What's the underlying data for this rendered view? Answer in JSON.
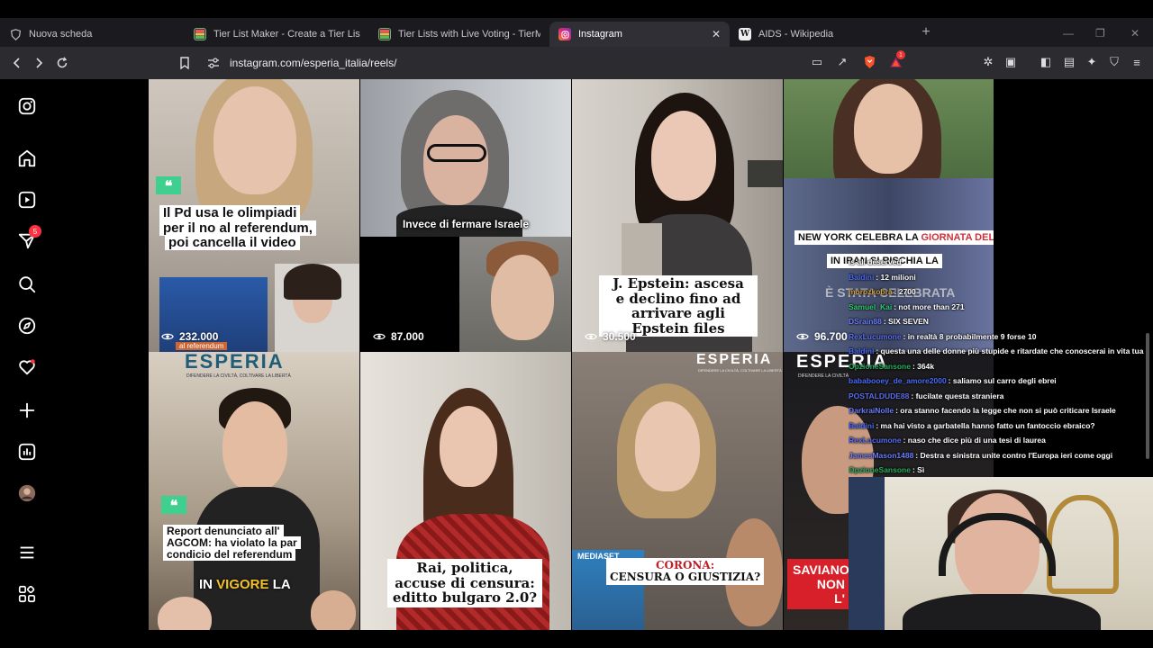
{
  "browser": {
    "tabs": [
      {
        "label": "Nuova scheda",
        "icon": "brave-shield-icon",
        "active": false
      },
      {
        "label": "Tier List Maker - Create a Tier List - T",
        "icon": "tiermaker-icon",
        "active": false
      },
      {
        "label": "Tier Lists with Live Voting - TierMaker",
        "icon": "tiermaker-icon",
        "active": false
      },
      {
        "label": "Instagram",
        "icon": "instagram-icon",
        "active": true
      },
      {
        "label": "AIDS - Wikipedia",
        "icon": "wikipedia-icon",
        "active": false
      }
    ],
    "new_tab": "+",
    "url": "instagram.com/esperia_italia/reels/",
    "rewards_badge": "1",
    "colors": {
      "tabbar": "#1b1b1f",
      "navbar": "#2b2b30",
      "active_tab": "#2f2f35",
      "brave_orange": "#fb542b"
    }
  },
  "sidebar": {
    "items": [
      {
        "name": "instagram-logo-icon"
      },
      {
        "name": "home-icon"
      },
      {
        "name": "reels-icon"
      },
      {
        "name": "messages-icon",
        "badge": "5"
      },
      {
        "name": "search-icon"
      },
      {
        "name": "explore-icon"
      },
      {
        "name": "notifications-icon"
      },
      {
        "name": "create-icon"
      },
      {
        "name": "dashboard-icon"
      },
      {
        "name": "profile-avatar"
      },
      {
        "name": "more-menu-icon"
      },
      {
        "name": "also-from-meta-icon"
      }
    ]
  },
  "reels": [
    {
      "caption": [
        "Il Pd usa le olimpiadi",
        "per il no al referendum,",
        "poi cancella il video"
      ],
      "views": "232.000",
      "sub_label": "al referendum"
    },
    {
      "caption": [
        "Invece di fermare Israele"
      ],
      "views": "87.000"
    },
    {
      "caption": [
        "J. Epstein: ascesa",
        "e declino fino ad",
        "arrivare agli",
        "Epstein files"
      ],
      "views": "30.500"
    },
    {
      "caption": [
        "NEW YORK CELEBRA LA GIORNATA DELL'HIJAB",
        "IN IRAN SI RISCHIA LA",
        "È STATA CELEBRATA"
      ],
      "highlight": "GIORNATA DELL'HIJAB",
      "views": "96.700"
    },
    {
      "brand": "ESPERIA",
      "brand_sub": "DIFENDERE LA CIVILTÀ, COLTIVARE LA LIBERTÀ",
      "caption": [
        "Report denunciato all'",
        "AGCOM: ha violato la par",
        "condicio del referendum"
      ],
      "banner": "IN VIGORE LA",
      "banner_highlight": "VIGORE"
    },
    {
      "caption": [
        "Rai, politica,",
        "accuse di censura:",
        "editto bulgaro 2.0?"
      ]
    },
    {
      "brand": "ESPERIA",
      "brand_sub": "DIFENDERE LA CIVILTÀ, COLTIVARE LA LIBERTÀ",
      "caption": [
        "CORONA:",
        "CENSURA O GIUSTIZIA?"
      ],
      "sub_label": "MEDIASET"
    },
    {
      "brand": "ESPERIA",
      "brand_sub": "DIFENDERE LA CIVILTÀ",
      "caption": [
        "SAVIANO",
        "NON",
        "L'"
      ]
    }
  ],
  "chat": [
    {
      "user": "",
      "text": "is all deserved",
      "color": "#ffffff"
    },
    {
      "user": "Baldini",
      "text": ": 12 milioni",
      "color": "#4a6cf7"
    },
    {
      "user": "morozkobra",
      "text": ": 2700",
      "color": "#d0a040"
    },
    {
      "user": "Samuel_Kai",
      "text": ": not more than 271",
      "color": "#2ecc71"
    },
    {
      "user": "DSrain88",
      "text": ": SIX SEVEN",
      "color": "#6a7cff"
    },
    {
      "user": "RexLucumone",
      "text": ": in realtà 8 probabilmente 9 forse 10",
      "color": "#5a6df0"
    },
    {
      "user": "Baldini",
      "text": ": questa una delle donne più stupide e ritardate che conoscerai in vita tua",
      "color": "#4a6cf7"
    },
    {
      "user": "OpzioneSansone",
      "text": ": 364k",
      "color": "#27ae60"
    },
    {
      "user": "bababooey_de_amore2000",
      "text": ": saliamo sul carro degli ebrei",
      "color": "#4a6cf7"
    },
    {
      "user": "POSTALDUDE88",
      "text": ": fucilate questa straniera",
      "color": "#5a6df0"
    },
    {
      "user": "DarkraiNolle",
      "text": ": ora stanno facendo la legge che non si può criticare Israele",
      "color": "#6a7cff"
    },
    {
      "user": "Baldini",
      "text": ": ma hai visto a garbatella hanno fatto un fantoccio ebraico?",
      "color": "#4a6cf7"
    },
    {
      "user": "RexLucumone",
      "text": ": naso che dice più di una tesi di laurea",
      "color": "#5a6df0"
    },
    {
      "user": "JamesMason1488",
      "text": ": Destra e sinistra unite contro l'Europa ieri come oggi",
      "color": "#6a7cff"
    },
    {
      "user": "OpzioneSansone",
      "text": ": Sì",
      "color": "#27ae60"
    }
  ]
}
